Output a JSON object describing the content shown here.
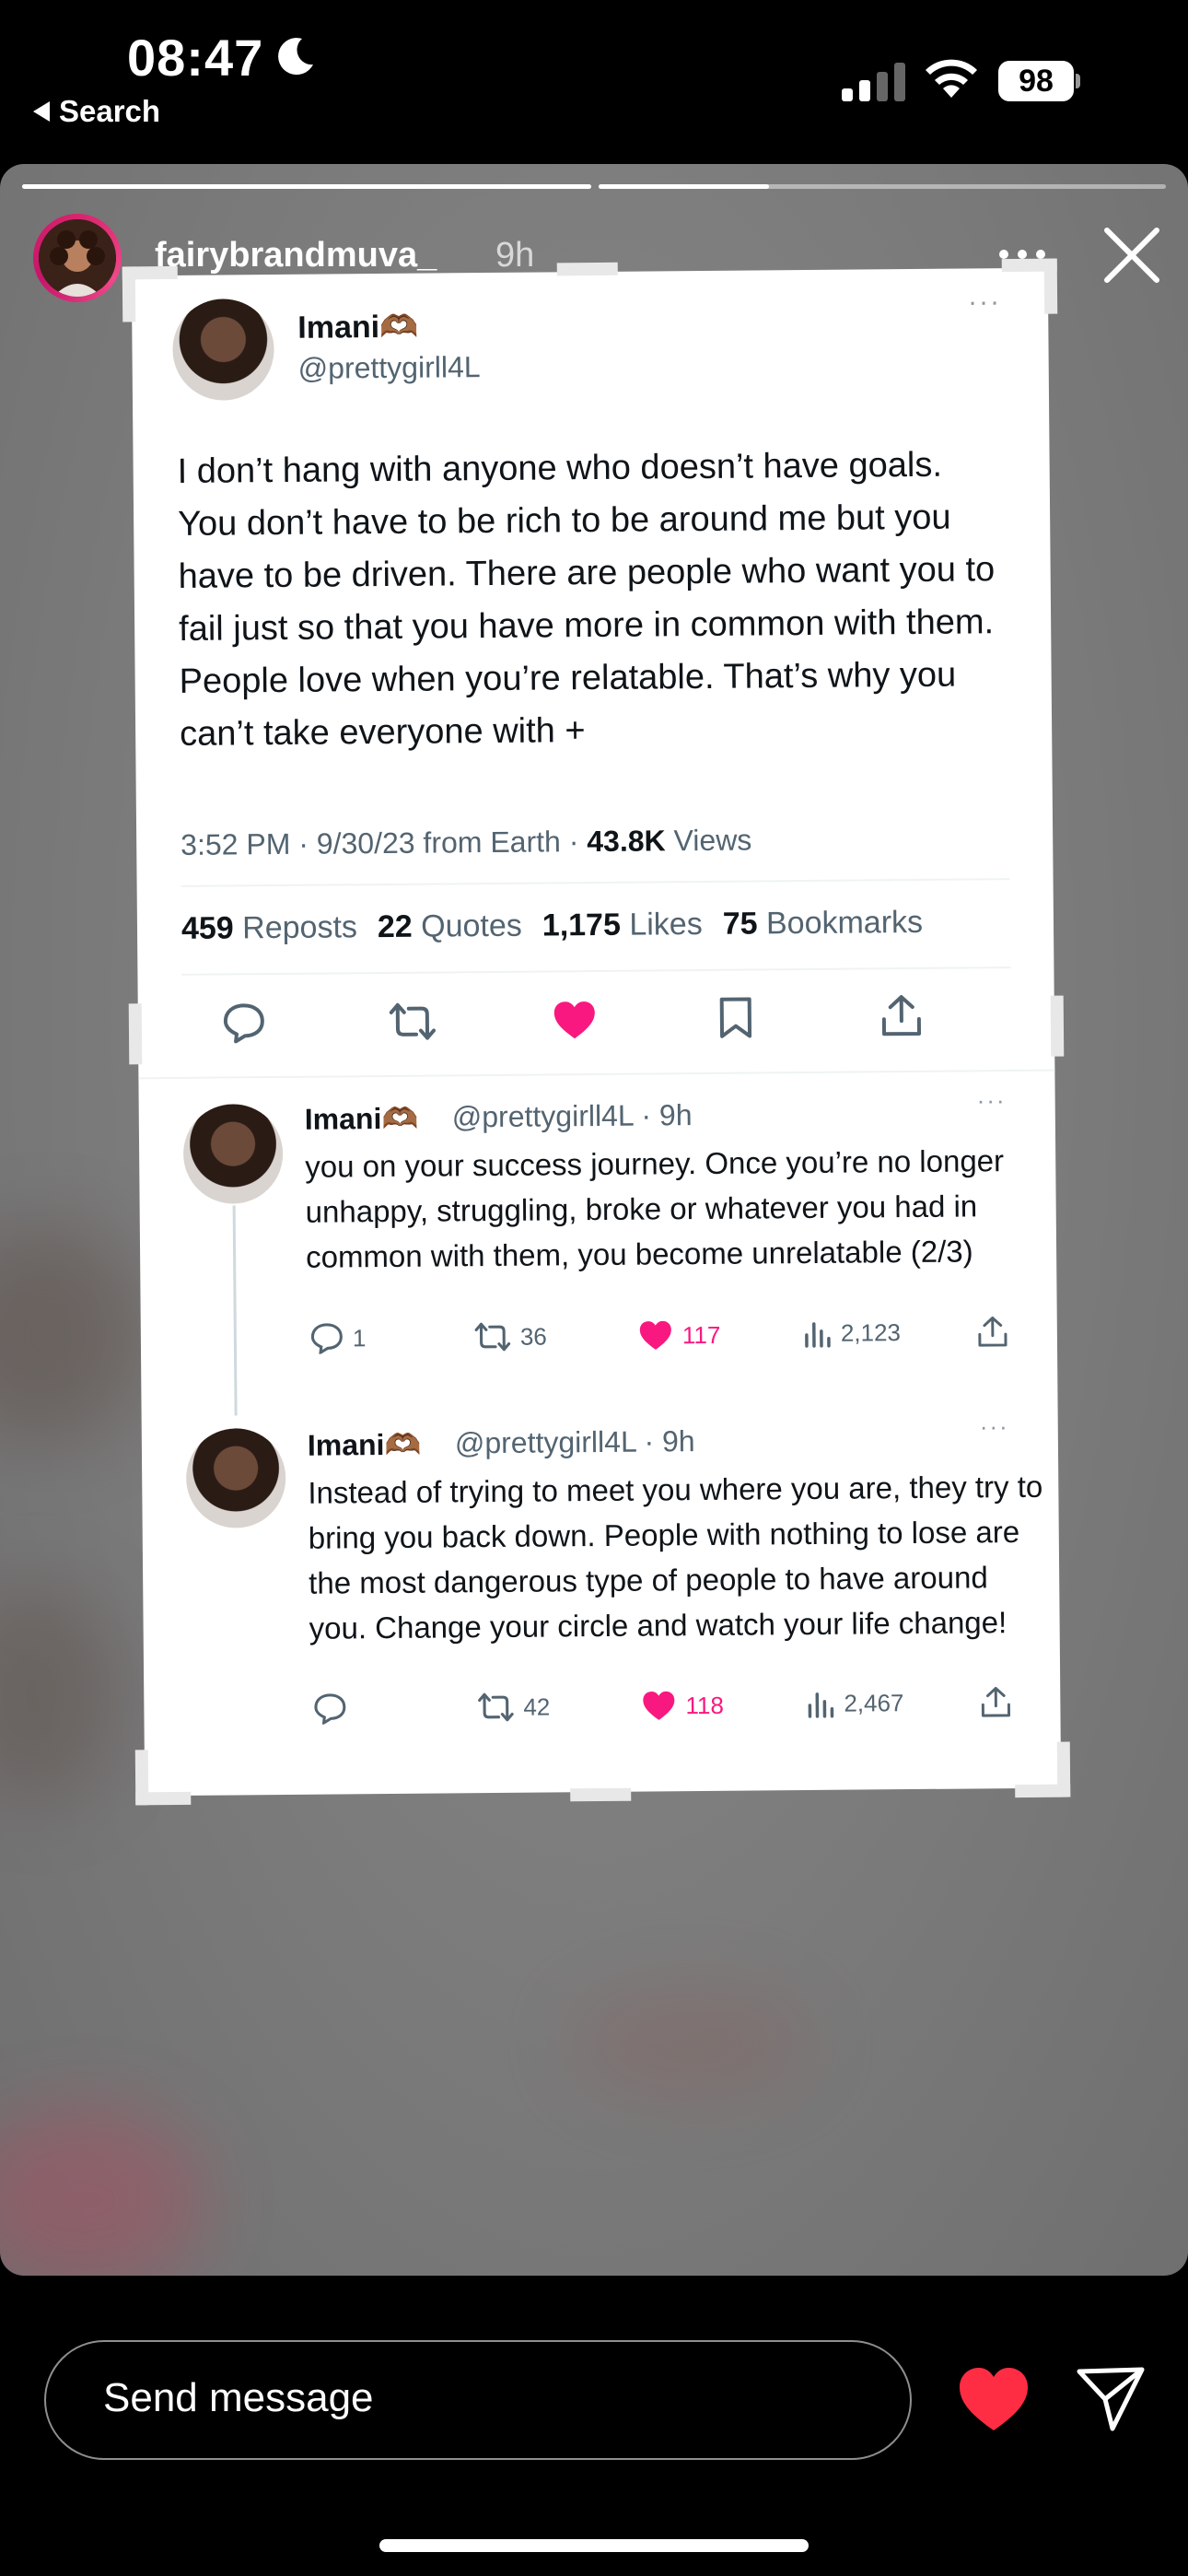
{
  "status_bar": {
    "time": "08:47",
    "back_label": "Search",
    "battery": "98"
  },
  "story": {
    "username": "fairybrandmuva_",
    "time_ago": "9h",
    "progress": [
      1.0,
      0.3
    ]
  },
  "tweet": {
    "name": "Imani🫶🏾",
    "handle": "@prettygirll4L",
    "text": "I don’t hang with anyone who doesn’t have goals. You don’t have to be rich to be around me but you have to be driven. There are people who want you to fail just so that you have more in common with them. People love when you’re relatable. That’s why you can’t take everyone with +",
    "meta_time": "3:52 PM · 9/30/23 from Earth · ",
    "views_count": "43.8K",
    "views_label": " Views",
    "stats": [
      {
        "count": "459",
        "label": "Reposts"
      },
      {
        "count": "22",
        "label": "Quotes"
      },
      {
        "count": "1,175",
        "label": "Likes"
      },
      {
        "count": "75",
        "label": "Bookmarks"
      }
    ]
  },
  "replies": [
    {
      "name": "Imani🫶🏾",
      "meta": "@prettygirll4L · 9h",
      "text": "you on your success journey. Once you’re no longer unhappy, struggling, broke or whatever you had in common with them, you become unrelatable (2/3)",
      "replies": "1",
      "reposts": "36",
      "likes": "117",
      "views": "2,123"
    },
    {
      "name": "Imani🫶🏾",
      "meta": "@prettygirll4L · 9h",
      "text": "Instead of trying to meet you where you are, they try to bring you back down. People with nothing to lose are the most dangerous type of people to have around you. Change your circle and watch your life change!",
      "replies": "",
      "reposts": "42",
      "likes": "118",
      "views": "2,467"
    }
  ],
  "bottom_bar": {
    "placeholder": "Send message"
  },
  "colors": {
    "like": "#f91880",
    "story_heart": "#ff2d44",
    "ring": "#d8236d"
  }
}
